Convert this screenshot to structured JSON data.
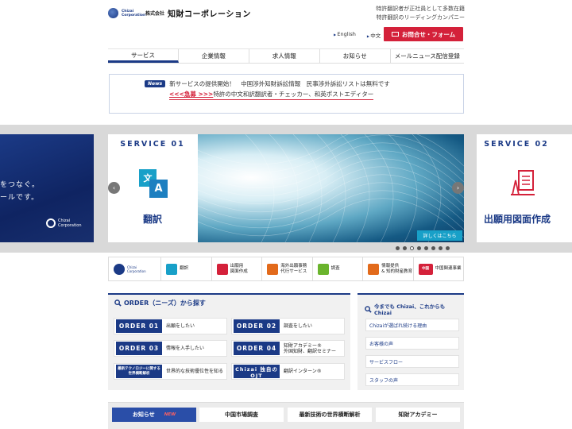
{
  "header": {
    "logo_corp": "Chizai Corporation",
    "logo_kk": "株式会社",
    "logo_name": "知財コーポレーション",
    "tagline1": "特許翻訳者が正社員として多数在籍",
    "tagline2": "特許翻訳のリーディングカンパニー",
    "lang_en": "English",
    "lang_zh": "中文",
    "contact_label": "お問合せ・フォーム"
  },
  "nav": {
    "tabs": [
      "サービス",
      "企業情報",
      "求人情報",
      "お知らせ",
      "メールニュース配信登録"
    ],
    "active": "サービス"
  },
  "news": {
    "tag": "News",
    "line1": "新サービスの提供開始！　中国渉外知財訴訟情報　民事渉外訴訟リストは無料です",
    "urgent": "<<<急募 >>>",
    "line2": "特許の中文和訳翻訳者・チェッカー、和英ポストエディター"
  },
  "slider": {
    "left_line1": "をつなぐ。",
    "left_line2": "ールです。",
    "left_logo": "Chizai Corporation",
    "svc1_title": "SERVICE 01",
    "svc1_name": "翻訳",
    "svc1_icon_a": "文",
    "svc1_icon_b": "A",
    "svc2_title": "SERVICE 02",
    "svc2_name": "出願用図面作成",
    "more_label": "詳しくはこちら",
    "prev_icon": "chevron-left-icon",
    "next_icon": "chevron-right-icon",
    "dots_total": 8,
    "dots_active": 2
  },
  "service_bar": [
    {
      "label": "Chizai Corporation",
      "icon": "chizai-logo-icon",
      "color": "#1b3a86"
    },
    {
      "label": "翻訳",
      "icon": "translation-icon",
      "color": "#18a0c8"
    },
    {
      "label": "出願用\n図面作成",
      "icon": "drawing-icon",
      "color": "#d4213a"
    },
    {
      "label": "海外出願事務\n代行サービス",
      "icon": "filing-icon",
      "color": "#e26a1b"
    },
    {
      "label": "調査",
      "icon": "bulb-icon",
      "color": "#6ab42d"
    },
    {
      "label": "情報提供\n& 知的財産教育",
      "icon": "education-icon",
      "color": "#e26a1b"
    },
    {
      "label": "中国関連事業",
      "icon": "china-icon",
      "color": "#d4213a",
      "icon_text": "中国"
    }
  ],
  "order": {
    "title": "ORDER（ニーズ）から探す",
    "items": [
      {
        "label": "ORDER 01",
        "text": "出願をしたい"
      },
      {
        "label": "ORDER 02",
        "text": "調査をしたい"
      },
      {
        "label": "ORDER 03",
        "text": "情報を入手したい"
      },
      {
        "label": "ORDER 04",
        "text": "知財アカデミー®\n外国知財、翻訳セミナー"
      },
      {
        "label": "最新テクノロジーに関する\n世界横断解析",
        "text": "世界的な技術優位性を知る"
      },
      {
        "label": "Chizai 独自のOJT",
        "text": "翻訳インターン®"
      }
    ]
  },
  "chizai": {
    "title": "今までも Chizai、これからも Chizai",
    "links": [
      "Chizaiが選ばれ続ける理由",
      "お客様の声",
      "サービスフロー",
      "スタッフの声"
    ]
  },
  "bottom_tabs": {
    "tabs": [
      "お知らせ",
      "中国市場調査",
      "最新技術の世界横断解析",
      "知財アカデミー"
    ],
    "new_badge": "NEW"
  },
  "colors": {
    "brand": "#1b3a86",
    "accent": "#d4213a",
    "cyan": "#18a0c8"
  }
}
